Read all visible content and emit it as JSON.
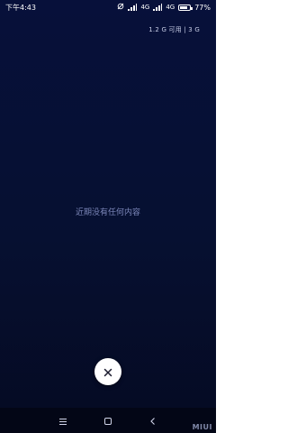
{
  "status_bar": {
    "time": "下午4:43",
    "network_1": "4G",
    "network_2": "4G",
    "battery": "77%",
    "battery_level": 0.77
  },
  "memory_info": "1.2 G 可用 | 3 G",
  "empty_message": "近期没有任何内容",
  "navigation": {
    "menu_icon": "menu-icon",
    "home_icon": "home-icon",
    "back_icon": "back-icon"
  },
  "brand_badge": "MIUI",
  "colors": {
    "background": "#07103a",
    "close_button": "#ffffff"
  }
}
